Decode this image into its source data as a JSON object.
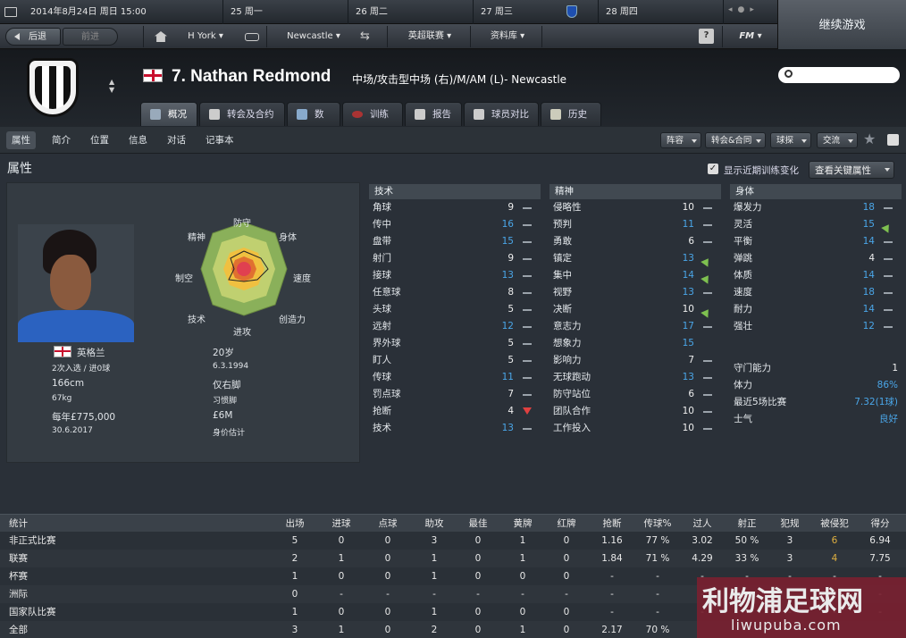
{
  "topbar": {
    "date": "2014年8月24日 周日 15:00",
    "days": [
      {
        "num": "25",
        "day": "周一"
      },
      {
        "num": "26",
        "day": "周二"
      },
      {
        "num": "27",
        "day": "周三"
      },
      {
        "num": "28",
        "day": "周四"
      }
    ]
  },
  "nav": {
    "back": "后退",
    "forward": "前进",
    "home_team": "H York",
    "club": "Newcastle",
    "league": "英超联赛",
    "database": "资料库",
    "help": "?",
    "fm": "FM",
    "continue": "继续游戏"
  },
  "player": {
    "title": "7. Nathan Redmond",
    "position": "中场/攻击型中场 (右)/M/AM (L)- Newcastle"
  },
  "tabs": [
    "概况",
    "转会及合约",
    "数据",
    "训练",
    "报告",
    "球员对比",
    "历史"
  ],
  "subtabs": [
    "属性",
    "简介",
    "位置",
    "信息",
    "对话",
    "记事本"
  ],
  "subdrops": [
    "阵容",
    "转会&合同",
    "球探",
    "交流"
  ],
  "section": {
    "title": "属性",
    "show_training": "显示近期训练变化",
    "key_attr": "查看关键属性"
  },
  "radar": {
    "labels": [
      "防守",
      "身体",
      "速度",
      "创造力",
      "进攻",
      "技术",
      "制空",
      "精神"
    ]
  },
  "profile": {
    "nation": "英格兰",
    "age": "20岁",
    "caps": "2次入选 / 进0球",
    "dob": "6.3.1994",
    "height": "166cm",
    "foot": "仅右脚",
    "weight": "67kg",
    "foot_label": "习惯脚",
    "wage": "每年£775,000",
    "value": "£6M",
    "contract": "30.6.2017",
    "value_label": "身价估计"
  },
  "technical": {
    "header": "技术",
    "rows": [
      {
        "n": "角球",
        "v": "9",
        "t": "-"
      },
      {
        "n": "传中",
        "v": "16",
        "t": "-",
        "hl": true
      },
      {
        "n": "盘带",
        "v": "15",
        "t": "-",
        "hl": true
      },
      {
        "n": "射门",
        "v": "9",
        "t": "-"
      },
      {
        "n": "接球",
        "v": "13",
        "t": "-",
        "hl": true
      },
      {
        "n": "任意球",
        "v": "8",
        "t": "-"
      },
      {
        "n": "头球",
        "v": "5",
        "t": "-"
      },
      {
        "n": "远射",
        "v": "12",
        "t": "-",
        "hl": true
      },
      {
        "n": "界外球",
        "v": "5",
        "t": "-"
      },
      {
        "n": "盯人",
        "v": "5",
        "t": "-"
      },
      {
        "n": "传球",
        "v": "11",
        "t": "-",
        "hl": true
      },
      {
        "n": "罚点球",
        "v": "7",
        "t": "-"
      },
      {
        "n": "抢断",
        "v": "4",
        "t": "down"
      },
      {
        "n": "技术",
        "v": "13",
        "t": "-",
        "hl": true
      }
    ]
  },
  "mental": {
    "header": "精神",
    "rows": [
      {
        "n": "侵略性",
        "v": "10",
        "t": "-"
      },
      {
        "n": "预判",
        "v": "11",
        "t": "-",
        "hl": true
      },
      {
        "n": "勇敢",
        "v": "6",
        "t": "-"
      },
      {
        "n": "镇定",
        "v": "13",
        "t": "up",
        "hl": true
      },
      {
        "n": "集中",
        "v": "14",
        "t": "up",
        "hl": true
      },
      {
        "n": "视野",
        "v": "13",
        "t": "-",
        "hl": true
      },
      {
        "n": "决断",
        "v": "10",
        "t": "up"
      },
      {
        "n": "意志力",
        "v": "17",
        "t": "-",
        "hl": true
      },
      {
        "n": "想象力",
        "v": "15",
        "t": "",
        "hl": true
      },
      {
        "n": "影响力",
        "v": "7",
        "t": "-"
      },
      {
        "n": "无球跑动",
        "v": "13",
        "t": "-",
        "hl": true
      },
      {
        "n": "防守站位",
        "v": "6",
        "t": "-"
      },
      {
        "n": "团队合作",
        "v": "10",
        "t": "-"
      },
      {
        "n": "工作投入",
        "v": "10",
        "t": "-"
      }
    ]
  },
  "physical": {
    "header": "身体",
    "rows": [
      {
        "n": "爆发力",
        "v": "18",
        "t": "-",
        "hl": true
      },
      {
        "n": "灵活",
        "v": "15",
        "t": "up",
        "hl": true
      },
      {
        "n": "平衡",
        "v": "14",
        "t": "-",
        "hl": true
      },
      {
        "n": "弹跳",
        "v": "4",
        "t": "-"
      },
      {
        "n": "体质",
        "v": "14",
        "t": "-",
        "hl": true
      },
      {
        "n": "速度",
        "v": "18",
        "t": "-",
        "hl": true
      },
      {
        "n": "耐力",
        "v": "14",
        "t": "-",
        "hl": true
      },
      {
        "n": "强壮",
        "v": "12",
        "t": "-",
        "hl": true
      }
    ],
    "extra": [
      {
        "n": "守门能力",
        "v": "1"
      },
      {
        "n": "体力",
        "v": "86%"
      },
      {
        "n": "最近5场比赛",
        "v": "7.32(1球)"
      },
      {
        "n": "士气",
        "v": "良好"
      }
    ]
  },
  "stats": {
    "headers": [
      "统计",
      "出场",
      "进球",
      "点球",
      "助攻",
      "最佳",
      "黄牌",
      "红牌",
      "抢断",
      "传球%",
      "过人",
      "射正",
      "犯规",
      "被侵犯",
      "得分"
    ],
    "rows": [
      [
        "非正式比赛",
        "5",
        "0",
        "0",
        "3",
        "0",
        "1",
        "0",
        "1.16",
        "77 %",
        "3.02",
        "50 %",
        "3",
        "6",
        "6.94"
      ],
      [
        "联赛",
        "2",
        "1",
        "0",
        "1",
        "0",
        "1",
        "0",
        "1.84",
        "71 %",
        "4.29",
        "33 %",
        "3",
        "4",
        "7.75"
      ],
      [
        "杯赛",
        "1",
        "0",
        "0",
        "1",
        "0",
        "0",
        "0",
        "-",
        "-",
        "-",
        "-",
        "-",
        "-",
        "-"
      ],
      [
        "洲际",
        "0",
        "-",
        "-",
        "-",
        "-",
        "-",
        "-",
        "-",
        "-",
        "-",
        "-",
        "-",
        "-",
        "-"
      ],
      [
        "国家队比赛",
        "1",
        "0",
        "0",
        "1",
        "0",
        "0",
        "0",
        "-",
        "-",
        "-",
        "-",
        "-",
        "-",
        "-"
      ],
      [
        "全部",
        "3",
        "1",
        "0",
        "2",
        "0",
        "1",
        "0",
        "2.17",
        "70 %",
        "",
        "",
        "",
        "",
        ""
      ]
    ]
  },
  "watermark": {
    "text": "利物浦足球网",
    "url": "liwupuba.com"
  }
}
